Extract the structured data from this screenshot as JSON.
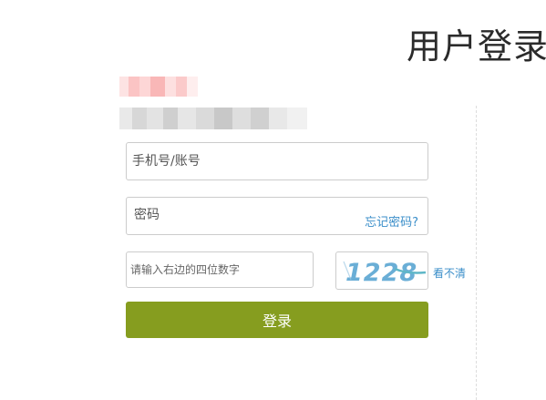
{
  "page": {
    "title": "用户登录"
  },
  "form": {
    "account": {
      "value": "",
      "placeholder": "手机号/账号"
    },
    "password": {
      "value": "",
      "placeholder": "密码"
    },
    "forgot_password_label": "忘记密码?",
    "captcha": {
      "value": "",
      "placeholder": "请输入右边的四位数字",
      "image_text": "1228",
      "refresh_label": "看不清"
    },
    "submit_label": "登录"
  },
  "colors": {
    "accent": "#869d1f",
    "link": "#3a8ec9",
    "captcha_text": "#6aaed6",
    "border": "#cccccc"
  }
}
